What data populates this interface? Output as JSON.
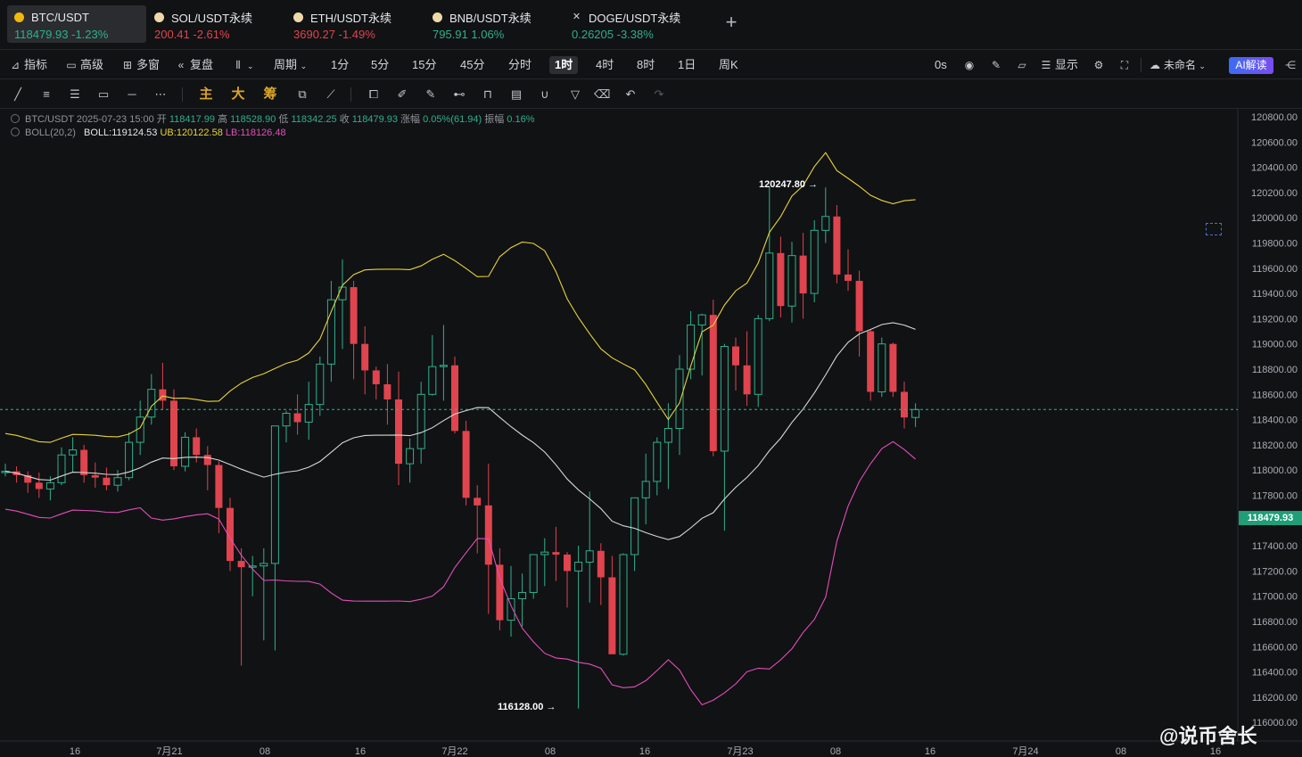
{
  "tabs": [
    {
      "symbol": "BTC/USDT",
      "price": "118479.93",
      "change": "-1.23%",
      "dir": "up",
      "icon_color": "#f0b90b",
      "active": true
    },
    {
      "symbol": "SOL/USDT永续",
      "price": "200.41",
      "change": "-2.61%",
      "dir": "down",
      "icon_color": "#f0d9a8",
      "active": false
    },
    {
      "symbol": "ETH/USDT永续",
      "price": "3690.27",
      "change": "-1.49%",
      "dir": "down",
      "icon_color": "#f0d9a8",
      "active": false
    },
    {
      "symbol": "BNB/USDT永续",
      "price": "795.91",
      "change": "1.06%",
      "dir": "up",
      "icon_color": "#f0d9a8",
      "active": false
    },
    {
      "symbol": "DOGE/USDT永续",
      "price": "0.26205",
      "change": "-3.38%",
      "dir": "up",
      "icon": "close-icon",
      "active": false
    }
  ],
  "toolbar": {
    "indicators": "指标",
    "advanced": "高级",
    "multi_window": "多窗",
    "replay": "复盘",
    "chart_type_icon": "candles-icon",
    "period": "周期",
    "periods": [
      "1分",
      "5分",
      "15分",
      "45分",
      "分时",
      "1时",
      "4时",
      "8时",
      "1日",
      "周K"
    ],
    "selected_period": "1时",
    "countdown": "0s",
    "display": "显示",
    "layout_name": "未命名",
    "ai_button": "AI解读"
  },
  "drawing_tools": {
    "main": "主",
    "big": "大",
    "chips": "筹",
    "icons": [
      "trend-line-icon",
      "parallel-lines-icon",
      "horizontal-lines-icon",
      "rectangle-icon",
      "horizontal-ray-icon",
      "more-icon",
      "square-select-icon",
      "pen-icon",
      "brush-icon",
      "measure-icon",
      "lock-icon",
      "note-icon",
      "magnet-icon",
      "filter-icon",
      "trash-icon",
      "undo-icon",
      "redo-icon"
    ]
  },
  "legend": {
    "symbol": "BTC/USDT",
    "datetime": "2025-07-23 15:00",
    "open_label": "开",
    "open": "118417.99",
    "high_label": "高",
    "high": "118528.90",
    "low_label": "低",
    "low": "118342.25",
    "close_label": "收",
    "close": "118479.93",
    "change_label": "涨幅",
    "change": "0.05%(61.94)",
    "amp_label": "振幅",
    "amp": "0.16%",
    "boll_label": "BOLL(20,2)",
    "boll_mid": "BOLL:119124.53",
    "boll_ub": "UB:120122.58",
    "boll_lb": "LB:118126.48"
  },
  "price_axis": [
    "120800.00",
    "120600.00",
    "120400.00",
    "120200.00",
    "120000.00",
    "119800.00",
    "119600.00",
    "119400.00",
    "119200.00",
    "119000.00",
    "118800.00",
    "118600.00",
    "118400.00",
    "118200.00",
    "118000.00",
    "117800.00",
    "117600.00",
    "117400.00",
    "117200.00",
    "117000.00",
    "116800.00",
    "116600.00",
    "116400.00",
    "116200.00",
    "116000.00"
  ],
  "time_axis": [
    "16",
    "7月21",
    "08",
    "16",
    "7月22",
    "08",
    "16",
    "7月23",
    "08",
    "16",
    "7月24",
    "08",
    "16"
  ],
  "current_price": "118479.93",
  "high_marker": "120247.80",
  "low_marker": "116128.00",
  "watermark": "@说币舍长",
  "colors": {
    "up": "#2fb18a",
    "down": "#e0444e",
    "ub": "#e6d33a",
    "lb": "#e24fb9",
    "mid": "#d8d8d8"
  },
  "chart_data": {
    "type": "candlestick",
    "timeframe": "1h",
    "candles": [
      [
        117980,
        118050,
        117950,
        117990
      ],
      [
        117990,
        118030,
        117900,
        117960
      ],
      [
        117960,
        117990,
        117820,
        117900
      ],
      [
        117900,
        117980,
        117780,
        117850
      ],
      [
        117850,
        117950,
        117760,
        117900
      ],
      [
        117900,
        118180,
        117880,
        118120
      ],
      [
        118120,
        118260,
        117980,
        118160
      ],
      [
        118160,
        118200,
        117900,
        117960
      ],
      [
        117960,
        118060,
        117860,
        117940
      ],
      [
        117940,
        118020,
        117840,
        117880
      ],
      [
        117880,
        118000,
        117830,
        117940
      ],
      [
        117940,
        118300,
        117920,
        118220
      ],
      [
        118220,
        118550,
        118120,
        118420
      ],
      [
        118420,
        118760,
        118360,
        118640
      ],
      [
        118640,
        118850,
        118480,
        118550
      ],
      [
        118550,
        118640,
        118000,
        118030
      ],
      [
        118030,
        118300,
        117990,
        118260
      ],
      [
        118260,
        118330,
        118060,
        118120
      ],
      [
        118120,
        118190,
        117840,
        118040
      ],
      [
        118040,
        118070,
        117500,
        117700
      ],
      [
        117700,
        117780,
        117200,
        117280
      ],
      [
        117280,
        117380,
        116450,
        117230
      ],
      [
        117230,
        117320,
        117000,
        117240
      ],
      [
        117240,
        117380,
        116650,
        117260
      ],
      [
        117260,
        117700,
        116570,
        118350
      ],
      [
        118350,
        118470,
        118220,
        118450
      ],
      [
        118450,
        118600,
        118280,
        118380
      ],
      [
        118380,
        118700,
        118240,
        118520
      ],
      [
        118520,
        118900,
        118430,
        118840
      ],
      [
        118840,
        119500,
        118700,
        119350
      ],
      [
        119350,
        119670,
        118960,
        119450
      ],
      [
        119450,
        119500,
        118720,
        119000
      ],
      [
        119000,
        119140,
        118600,
        118790
      ],
      [
        118790,
        118820,
        118560,
        118680
      ],
      [
        118680,
        118840,
        118360,
        118560
      ],
      [
        118560,
        118780,
        117880,
        118050
      ],
      [
        118050,
        118250,
        117900,
        118170
      ],
      [
        118170,
        118700,
        118050,
        118600
      ],
      [
        118600,
        119070,
        118590,
        118820
      ],
      [
        118820,
        119150,
        118550,
        118830
      ],
      [
        118830,
        118900,
        118290,
        118310
      ],
      [
        118310,
        118390,
        117720,
        117780
      ],
      [
        117780,
        117880,
        117340,
        117720
      ],
      [
        117720,
        118050,
        116860,
        117250
      ],
      [
        117250,
        117380,
        116730,
        116810
      ],
      [
        116810,
        117240,
        116680,
        116980
      ],
      [
        116980,
        117180,
        116760,
        117030
      ],
      [
        117030,
        117290,
        116980,
        117330
      ],
      [
        117330,
        117460,
        117080,
        117350
      ],
      [
        117350,
        117550,
        117120,
        117330
      ],
      [
        117330,
        117350,
        116910,
        117200
      ],
      [
        117200,
        117400,
        116110,
        117270
      ],
      [
        117270,
        117830,
        116950,
        117360
      ],
      [
        117360,
        117420,
        116930,
        117150
      ],
      [
        117150,
        117320,
        116560,
        116540
      ],
      [
        116540,
        117340,
        116530,
        117330
      ],
      [
        117330,
        117770,
        117200,
        117780
      ],
      [
        117780,
        118130,
        117570,
        117910
      ],
      [
        117910,
        118260,
        117800,
        118220
      ],
      [
        118220,
        118530,
        117850,
        118330
      ],
      [
        118330,
        118910,
        118120,
        118800
      ],
      [
        118800,
        119260,
        118720,
        119150
      ],
      [
        119150,
        119240,
        118750,
        119230
      ],
      [
        119230,
        119350,
        118110,
        118150
      ],
      [
        118150,
        119000,
        117520,
        118980
      ],
      [
        118980,
        119050,
        118630,
        118830
      ],
      [
        118830,
        119100,
        118510,
        118600
      ],
      [
        118600,
        119230,
        118500,
        119200
      ],
      [
        119200,
        120250,
        119180,
        119720
      ],
      [
        119720,
        119850,
        119210,
        119300
      ],
      [
        119300,
        119810,
        119170,
        119700
      ],
      [
        119700,
        119880,
        119200,
        119400
      ],
      [
        119400,
        119980,
        119330,
        119900
      ],
      [
        119900,
        120240,
        119800,
        120010
      ],
      [
        120010,
        120100,
        119480,
        119550
      ],
      [
        119550,
        119750,
        119420,
        119500
      ],
      [
        119500,
        119580,
        118900,
        119100
      ],
      [
        119100,
        119110,
        118550,
        118620
      ],
      [
        118620,
        119050,
        118580,
        119000
      ],
      [
        119000,
        119010,
        118580,
        118620
      ],
      [
        118620,
        118700,
        118330,
        118417
      ],
      [
        118417,
        118529,
        118342,
        118480
      ]
    ],
    "boll": {
      "period": 20,
      "mult": 2
    }
  }
}
